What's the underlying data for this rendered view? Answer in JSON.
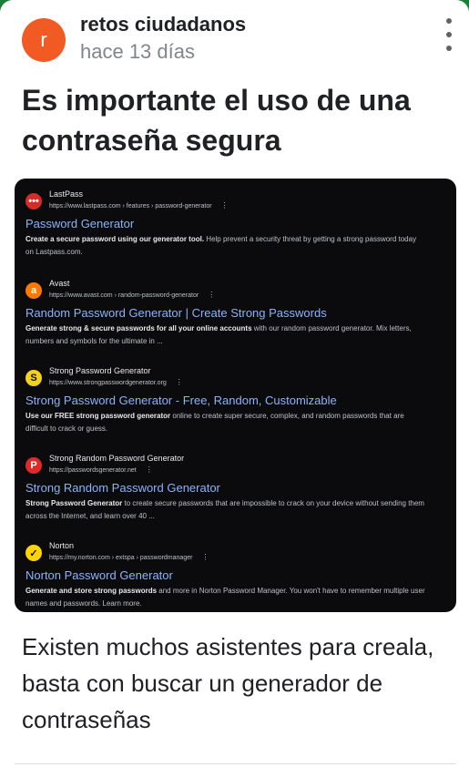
{
  "post": {
    "avatar_letter": "r",
    "author": "retos ciudadanos",
    "time": "hace 13 días",
    "title": "Es importante el uso de una contraseña segura",
    "body": "Existen muchos asistentes para creala, basta con buscar un generador de contraseñas"
  },
  "colors": {
    "avatar": "#f25a23",
    "link": "#8ab4f8",
    "screenshot_bg": "#0b0b0d"
  },
  "results": [
    {
      "site_name": "LastPass",
      "url": "https://www.lastpass.com › features › password-generator",
      "title": "Password Generator",
      "snippet_bold": "Create a secure password using our generator tool.",
      "snippet_rest": " Help prevent a security threat by getting a strong password today on Lastpass.com.",
      "icon": "lastpass-icon",
      "icon_glyph": "•••",
      "icon_bg": "#d32d27",
      "icon_color": "#ffffff"
    },
    {
      "site_name": "Avast",
      "url": "https://www.avast.com › random-password-generator",
      "title": "Random Password Generator | Create Strong Passwords",
      "snippet_bold": "Generate strong & secure passwords for all your online accounts",
      "snippet_rest": " with our random password generator. Mix letters, numbers and symbols for the ultimate in ...",
      "icon": "avast-icon",
      "icon_glyph": "a",
      "icon_bg": "#ff7800",
      "icon_color": "#ffffff"
    },
    {
      "site_name": "Strong Password Generator",
      "url": "https://www.strongpasswordgenerator.org",
      "title": "Strong Password Generator - Free, Random, Customizable",
      "snippet_bold": "Use our FREE strong password generator",
      "snippet_rest": " online to create super secure, complex, and random passwords that are difficult to crack or guess.",
      "icon": "strong-password-icon",
      "icon_glyph": "S",
      "icon_bg": "#f3d21a",
      "icon_color": "#111111"
    },
    {
      "site_name": "Strong Random Password Generator",
      "url": "https://passwordsgenerator.net",
      "title": "Strong Random Password Generator",
      "snippet_bold": "Strong Password Generator",
      "snippet_rest": " to create secure passwords that are impossible to crack on your device without sending them across the Internet, and learn over 40 ...",
      "icon": "passwordsgenerator-icon",
      "icon_glyph": "P",
      "icon_bg": "#e02a2a",
      "icon_color": "#ffffff"
    },
    {
      "site_name": "Norton",
      "url": "https://my.norton.com › extspa › passwordmanager",
      "title": "Norton Password Generator",
      "snippet_bold": "Generate and store strong passwords",
      "snippet_rest": " and more in Norton Password Manager. You won't have to remember multiple user names and passwords. Learn more.",
      "icon": "norton-icon",
      "icon_glyph": "✓",
      "icon_bg": "#ffd500",
      "icon_color": "#111111"
    }
  ]
}
